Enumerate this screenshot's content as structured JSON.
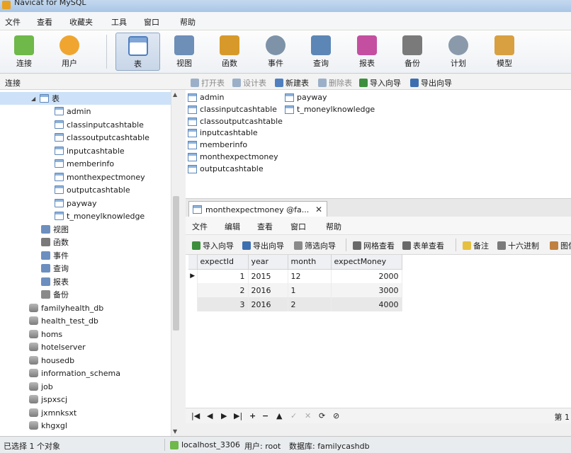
{
  "window": {
    "title": "Navicat for MySQL"
  },
  "menu": [
    "文件",
    "查看",
    "收藏夹",
    "工具",
    "窗口",
    "帮助"
  ],
  "toolbar": [
    {
      "label": "连接",
      "icon": "connect-icon",
      "color": "#6fb84a"
    },
    {
      "label": "用户",
      "icon": "user-icon",
      "color": "#f0a530"
    },
    {
      "label": "表",
      "icon": "table-icon",
      "color": "#4f7fbf",
      "active": true
    },
    {
      "label": "视图",
      "icon": "view-icon",
      "color": "#6d8fb8"
    },
    {
      "label": "函数",
      "icon": "function-icon",
      "color": "#d79a2a"
    },
    {
      "label": "事件",
      "icon": "event-icon",
      "color": "#7e93a8"
    },
    {
      "label": "查询",
      "icon": "query-icon",
      "color": "#5c86b5"
    },
    {
      "label": "报表",
      "icon": "report-icon",
      "color": "#c44fa0"
    },
    {
      "label": "备份",
      "icon": "backup-icon",
      "color": "#7a7a7a"
    },
    {
      "label": "计划",
      "icon": "schedule-icon",
      "color": "#8a9aab"
    },
    {
      "label": "模型",
      "icon": "model-icon",
      "color": "#d8a040"
    }
  ],
  "connection_header": "连接",
  "object_toolbar": [
    {
      "label": "打开表",
      "enabled": false,
      "icon": "open-table-icon",
      "color": "#9bb0c8"
    },
    {
      "label": "设计表",
      "enabled": false,
      "icon": "design-table-icon",
      "color": "#9bb0c8"
    },
    {
      "label": "新建表",
      "enabled": true,
      "icon": "new-table-icon",
      "color": "#4f7fbf"
    },
    {
      "label": "删除表",
      "enabled": false,
      "icon": "delete-table-icon",
      "color": "#9bb0c8"
    },
    {
      "label": "导入向导",
      "enabled": true,
      "icon": "import-wizard-icon",
      "color": "#3d8f3d"
    },
    {
      "label": "导出向导",
      "enabled": true,
      "icon": "export-wizard-icon",
      "color": "#3d6fb0"
    }
  ],
  "tree": {
    "tables_label": "表",
    "tables": [
      "admin",
      "classinputcashtable",
      "classoutputcashtable",
      "inputcashtable",
      "memberinfo",
      "monthexpectmoney",
      "outputcashtable",
      "payway",
      "t_moneylknowledge"
    ],
    "other_nodes": [
      {
        "label": "视图",
        "icon": "view-node-icon"
      },
      {
        "label": "函数",
        "icon": "function-node-icon"
      },
      {
        "label": "事件",
        "icon": "event-node-icon"
      },
      {
        "label": "查询",
        "icon": "query-node-icon"
      },
      {
        "label": "报表",
        "icon": "report-node-icon"
      },
      {
        "label": "备份",
        "icon": "backup-node-icon"
      }
    ],
    "databases": [
      "familyhealth_db",
      "health_test_db",
      "homs",
      "hotelserver",
      "housedb",
      "information_schema",
      "job",
      "jspxscj",
      "jxmnksxt",
      "khgxgl"
    ]
  },
  "object_list": {
    "col1": [
      "admin",
      "classinputcashtable",
      "classoutputcashtable",
      "inputcashtable",
      "memberinfo",
      "monthexpectmoney",
      "outputcashtable"
    ],
    "col2": [
      "payway",
      "t_moneylknowledge"
    ]
  },
  "tab": {
    "label": "monthexpectmoney @fa...",
    "close": "✕"
  },
  "inner_menu": [
    "文件",
    "编辑",
    "查看",
    "窗口",
    "帮助"
  ],
  "inner_toolbar": [
    {
      "label": "导入向导",
      "icon": "import-wizard-icon",
      "color": "#3d8f3d"
    },
    {
      "label": "导出向导",
      "icon": "export-wizard-icon",
      "color": "#3d6fb0"
    },
    {
      "label": "筛选向导",
      "icon": "filter-wizard-icon",
      "color": "#8a8a8a"
    },
    {
      "label": "网格查看",
      "icon": "grid-view-icon",
      "color": "#6a6a6a"
    },
    {
      "label": "表单查看",
      "icon": "form-view-icon",
      "color": "#6a6a6a"
    },
    {
      "label": "备注",
      "icon": "memo-icon",
      "color": "#e6c040"
    },
    {
      "label": "十六进制",
      "icon": "hex-icon",
      "color": "#7a7a7a"
    },
    {
      "label": "图像",
      "icon": "image-icon",
      "color": "#c08040"
    }
  ],
  "grid": {
    "columns": [
      "expectId",
      "year",
      "month",
      "expectMoney"
    ],
    "rows": [
      [
        "1",
        "2015",
        "12",
        "2000"
      ],
      [
        "2",
        "2016",
        "1",
        "3000"
      ],
      [
        "3",
        "2016",
        "2",
        "4000"
      ]
    ]
  },
  "navbar": {
    "buttons": [
      "|◀",
      "◀",
      "▶",
      "▶|",
      "+",
      "−",
      "▲",
      "✓",
      "✕",
      "⟳",
      "⊘"
    ],
    "page": "第 1"
  },
  "status": {
    "selection": "已选择 1 个对象",
    "host": "localhost_3306",
    "user": "用户: root",
    "database": "数据库: familycashdb"
  }
}
